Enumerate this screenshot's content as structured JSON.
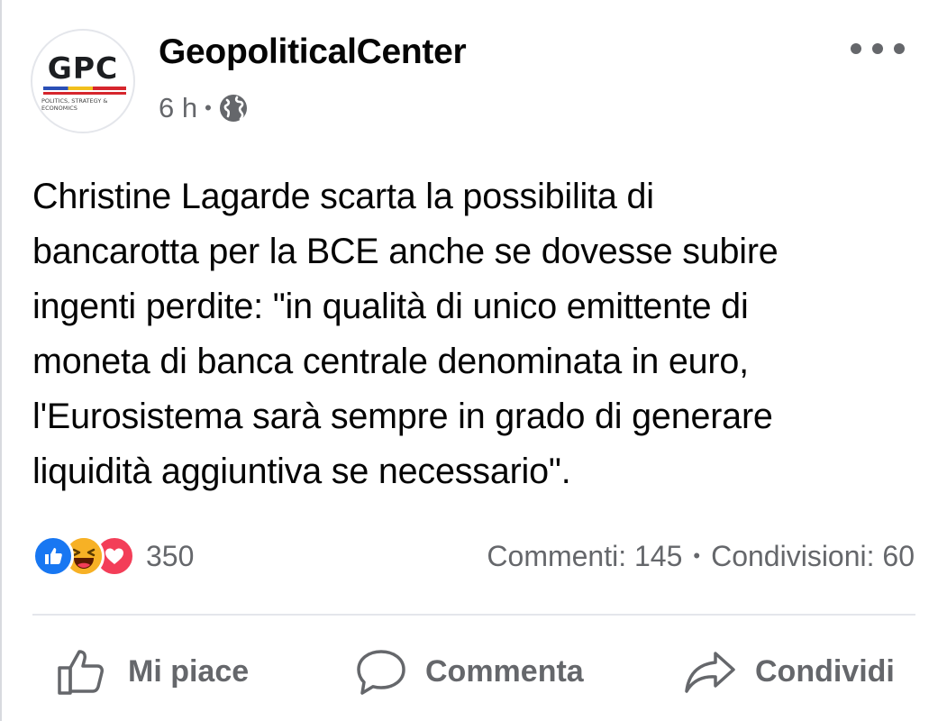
{
  "page": {
    "name": "GeopoliticalCenter",
    "avatar_logo_text": "GPC",
    "avatar_subtitle": "POLITICS, STRATEGY & ECONOMICS",
    "time": "6 h",
    "meta_separator": "•",
    "privacy_icon": "globe-icon"
  },
  "post": {
    "text": "Christine Lagarde scarta la possibilita di\nbancarotta per la BCE anche se dovesse subire\ningenti perdite: \"in qualità di unico emittente di\nmoneta di banca centrale denominata in euro,\nl'Eurosistema sarà sempre in grado di generare\nliquidità aggiuntiva se necessario\"."
  },
  "engagement": {
    "reaction_icons": [
      "like-reaction-icon",
      "haha-reaction-icon",
      "love-reaction-icon"
    ],
    "reaction_count": "350",
    "comments": "Commenti: 145",
    "separator": "•",
    "shares": "Condivisioni: 60"
  },
  "actions": {
    "like_label": "Mi piace",
    "comment_label": "Commenta",
    "share_label": "Condividi"
  },
  "colors": {
    "text_primary": "#050505",
    "text_secondary": "#65676b",
    "like_blue": "#1877f2",
    "haha_yellow": "#f7b125",
    "love_red": "#f33e58",
    "divider": "#e4e6eb"
  }
}
